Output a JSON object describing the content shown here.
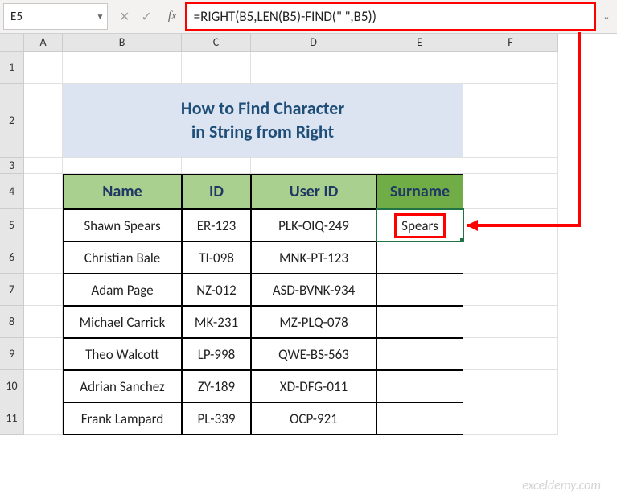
{
  "name_box": "E5",
  "formula": "=RIGHT(B5,LEN(B5)-FIND(\" \",B5))",
  "fx_label": "fx",
  "columns": [
    "A",
    "B",
    "C",
    "D",
    "E",
    "F"
  ],
  "rows": [
    "1",
    "2",
    "3",
    "4",
    "5",
    "6",
    "7",
    "8",
    "9",
    "10",
    "11"
  ],
  "title_line1": "How to Find Character",
  "title_line2": "in String from Right",
  "headers": {
    "name": "Name",
    "id": "ID",
    "userid": "User ID",
    "surname": "Surname"
  },
  "table": [
    {
      "name": "Shawn Spears",
      "id": "ER-123",
      "userid": "PLK-OIQ-249",
      "surname": "Spears"
    },
    {
      "name": "Christian Bale",
      "id": "TI-098",
      "userid": "MNK-PT-123",
      "surname": ""
    },
    {
      "name": "Adam Page",
      "id": "NZ-012",
      "userid": "ASD-BVNK-934",
      "surname": ""
    },
    {
      "name": "Michael Carrick",
      "id": "MK-231",
      "userid": "MZ-PLQ-078",
      "surname": ""
    },
    {
      "name": "Theo Walcott",
      "id": "LP-998",
      "userid": "QWE-BS-563",
      "surname": ""
    },
    {
      "name": "Adrian Sanchez",
      "id": "ZY-189",
      "userid": "XD-DFG-011",
      "surname": ""
    },
    {
      "name": "Frank Lampard",
      "id": "PL-339",
      "userid": "OCP-921",
      "surname": ""
    }
  ],
  "watermark": "exceldemy.com",
  "row_heights": {
    "r1": 40,
    "r2": 92,
    "r3": 20,
    "r4": 44,
    "data": 40
  }
}
